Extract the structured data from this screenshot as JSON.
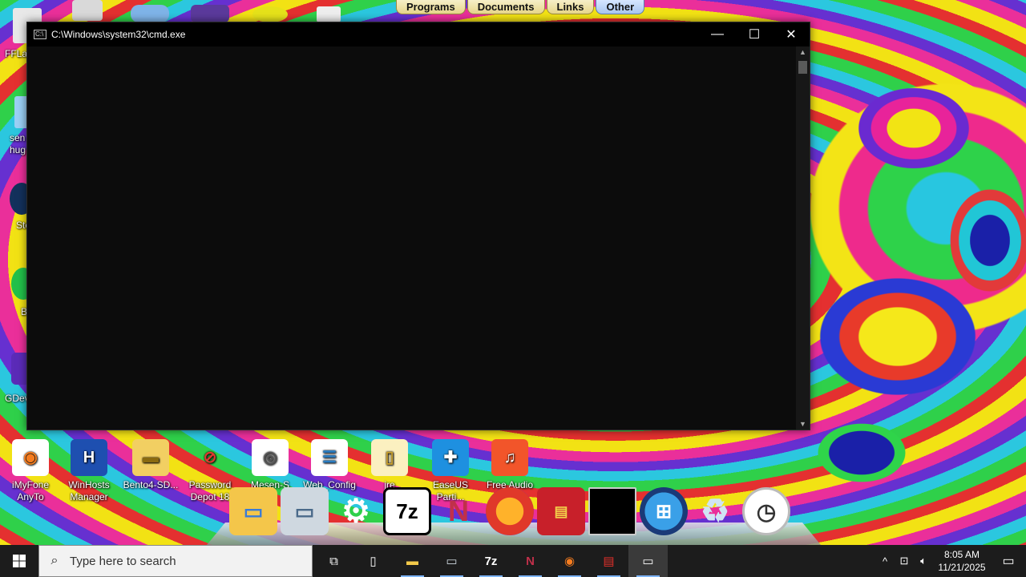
{
  "top_tabs": [
    "Programs",
    "Documents",
    "Links",
    "Other"
  ],
  "cmd": {
    "title": "C:\\Windows\\system32\\cmd.exe",
    "minimize": "—",
    "maximize": "☐",
    "close": "✕"
  },
  "left_icons": [
    "FFLau",
    "sen\nhug",
    "Ste",
    "B",
    "GDev"
  ],
  "desktop_icons": [
    {
      "label": "iMyFone AnyTo"
    },
    {
      "label": "WinHosts Manager"
    },
    {
      "label": "Bento4-SD..."
    },
    {
      "label": "Password Depot 18"
    },
    {
      "label": "Mesen-S"
    },
    {
      "label": "Web_Config"
    },
    {
      "label": "jre"
    },
    {
      "label": "EaseUS Parti..."
    },
    {
      "label": "Free Audio C..."
    }
  ],
  "dock_icons": [
    "folder-icon",
    "monitor-icon",
    "settings-gear-icon",
    "7zip-icon",
    "n-app-icon",
    "firefox-icon",
    "winrar-icon",
    "terminal-icon",
    "windows-orb-icon",
    "recycle-bin-icon",
    "clock-icon"
  ],
  "dock_labels": {
    "sevenzip": "7z"
  },
  "taskbar": {
    "search_placeholder": "Type here to search",
    "sevenzip_label": "7z",
    "time": "8:05 AM",
    "date": "11/21/2025"
  }
}
